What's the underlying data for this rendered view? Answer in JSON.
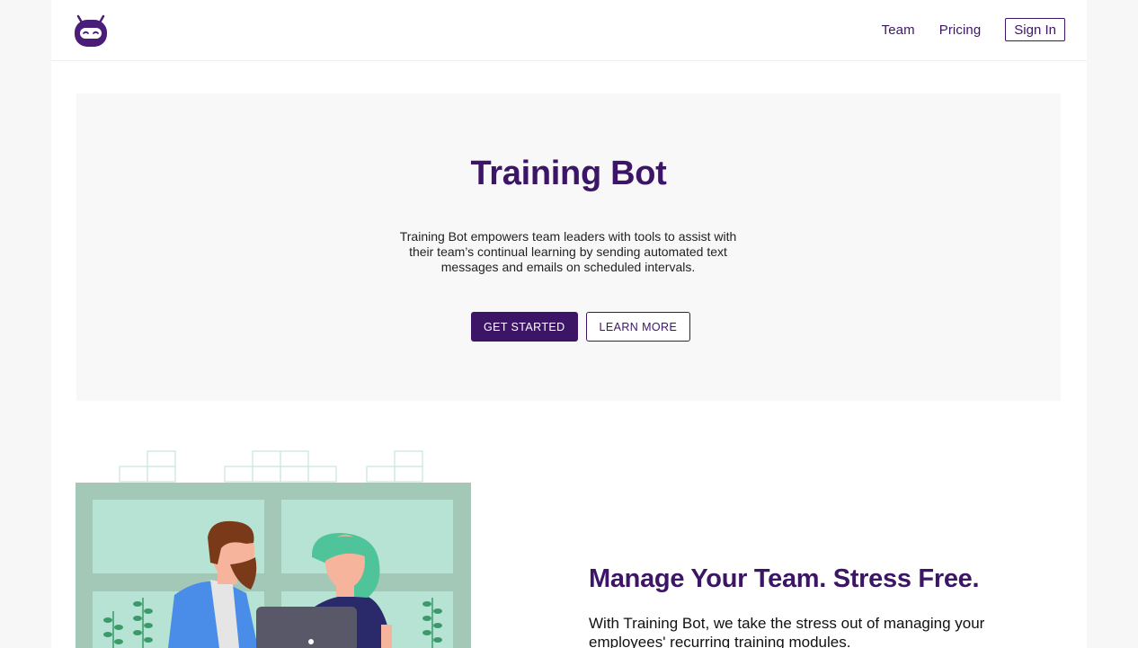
{
  "header": {
    "logo_icon": "robot-icon",
    "nav": [
      {
        "label": "Team"
      },
      {
        "label": "Pricing"
      }
    ],
    "signin_label": "Sign In"
  },
  "hero": {
    "title": "Training Bot",
    "description": "Training Bot empowers team leaders with tools to assist with their team’s continual learning by sending automated text messages and emails on scheduled intervals.",
    "primary_button": "GET STARTED",
    "secondary_button": "LEARN MORE"
  },
  "feature": {
    "title": "Manage Your Team. Stress Free.",
    "description": "With Training Bot, we take the stress out of managing your employees' recurring training modules."
  },
  "colors": {
    "brand": "#3d1566",
    "hero_bg": "#f8f8f8",
    "illustration_green": "#a3c8b8"
  }
}
